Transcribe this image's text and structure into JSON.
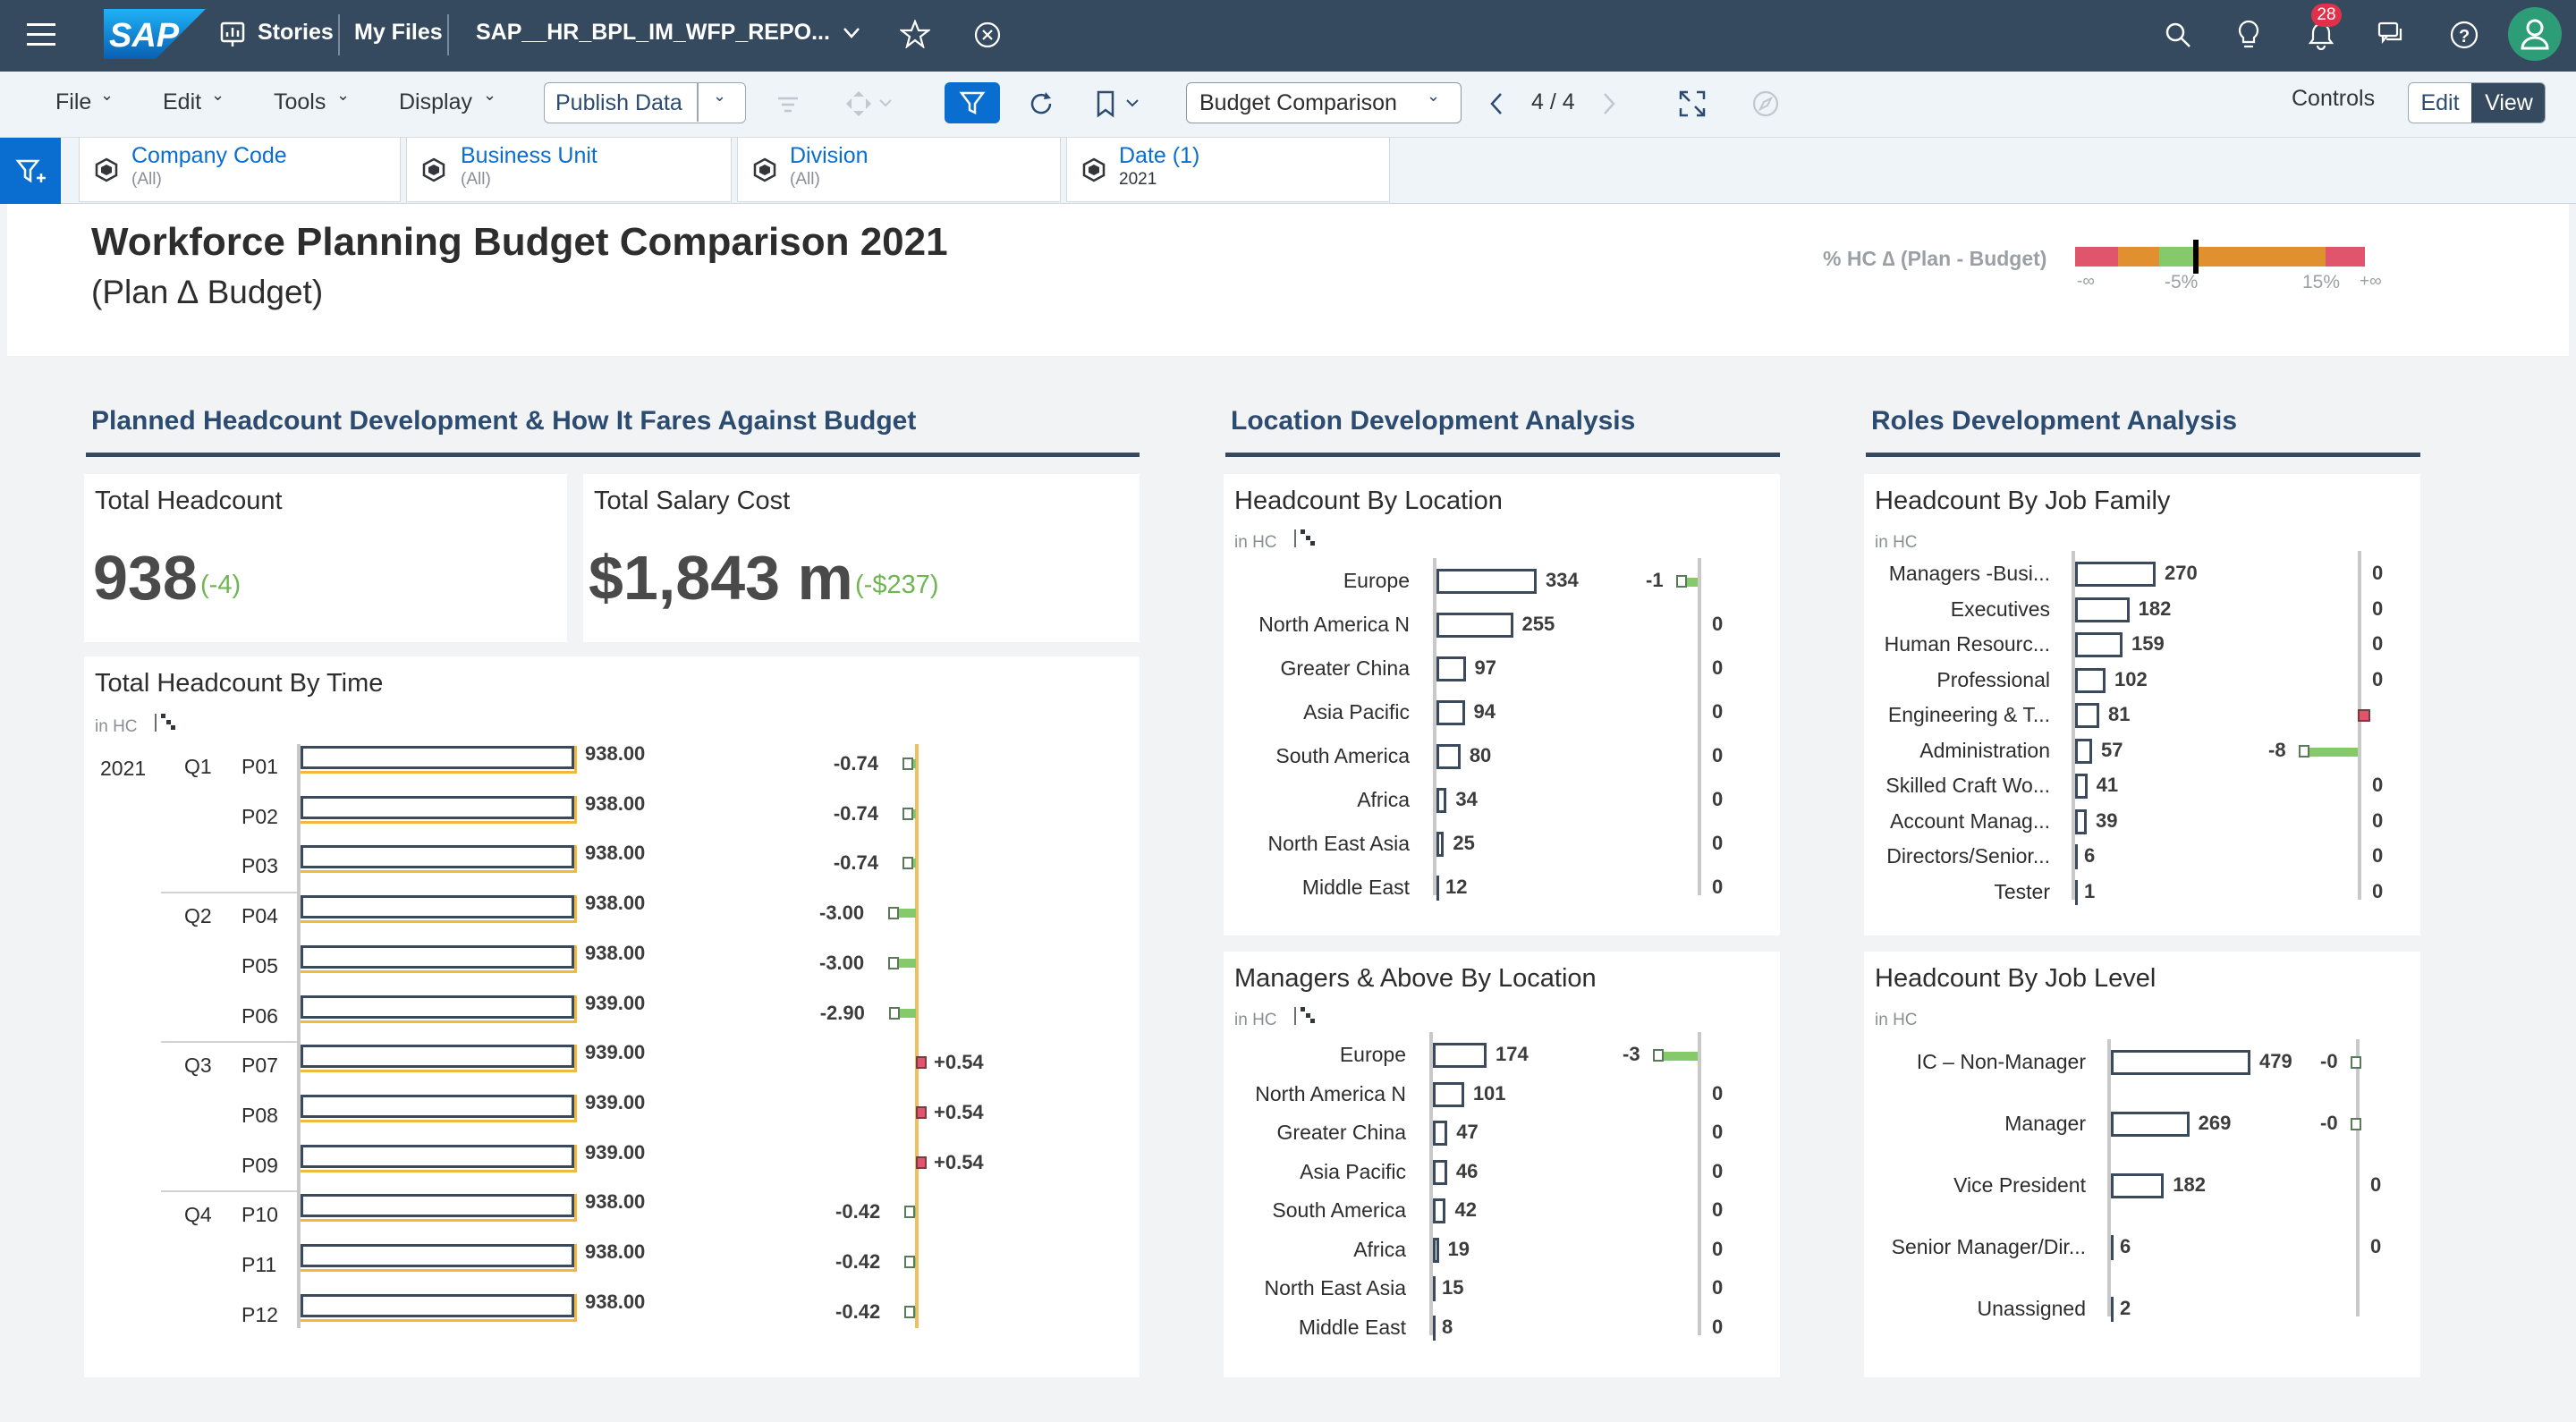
{
  "shell": {
    "nav_stories": "Stories",
    "nav_myfiles": "My Files",
    "doc_title": "SAP__HR_BPL_IM_WFP_REPO...",
    "notification_count": "28",
    "logo_text": "SAP"
  },
  "toolbar": {
    "menus": [
      "File",
      "Edit",
      "Tools",
      "Display"
    ],
    "publish_label": "Publish Data",
    "page_select": "Budget Comparison",
    "page_counter": "4 / 4",
    "controls_label": "Controls",
    "edit_label": "Edit",
    "view_label": "View"
  },
  "filters": [
    {
      "name": "Company Code",
      "value": "(All)"
    },
    {
      "name": "Business Unit",
      "value": "(All)"
    },
    {
      "name": "Division",
      "value": "(All)"
    },
    {
      "name": "Date (1)",
      "value": "2021"
    }
  ],
  "header": {
    "title": "Workforce Planning Budget Comparison 2021",
    "subtitle": "(Plan ∆ Budget)",
    "legend_label": "% HC ∆ (Plan - Budget)",
    "legend_ticks": [
      "-∞",
      "-5%",
      "15%",
      "+∞"
    ],
    "legend_colors": [
      "#e0556b",
      "#e0902f",
      "#86c96b",
      "#86c96b",
      "#e0902f",
      "#e0556b"
    ]
  },
  "sections": {
    "left": "Planned Headcount Development & How It Fares Against Budget",
    "mid": "Location Development Analysis",
    "right": "Roles Development Analysis"
  },
  "kpi": {
    "headcount_title": "Total Headcount",
    "headcount_value": "938",
    "headcount_delta": "(-4)",
    "salary_title": "Total Salary Cost",
    "salary_value": "$1,843 m",
    "salary_delta": "(-$237)"
  },
  "unit_label": "in HC",
  "chart_data": [
    {
      "type": "bar",
      "title": "Total Headcount By Time",
      "year": "2021",
      "quarters": [
        "Q1",
        "Q2",
        "Q3",
        "Q4"
      ],
      "categories": [
        "P01",
        "P02",
        "P03",
        "P04",
        "P05",
        "P06",
        "P07",
        "P08",
        "P09",
        "P10",
        "P11",
        "P12"
      ],
      "values": [
        938.0,
        938.0,
        938.0,
        938.0,
        938.0,
        939.0,
        939.0,
        939.0,
        939.0,
        938.0,
        938.0,
        938.0
      ],
      "value_labels": [
        "938.00",
        "938.00",
        "938.00",
        "938.00",
        "938.00",
        "939.00",
        "939.00",
        "939.00",
        "939.00",
        "938.00",
        "938.00",
        "938.00"
      ],
      "variance": [
        -0.74,
        -0.74,
        -0.74,
        -3.0,
        -3.0,
        -2.9,
        0.54,
        0.54,
        0.54,
        -0.42,
        -0.42,
        -0.42
      ],
      "variance_labels": [
        "-0.74",
        "-0.74",
        "-0.74",
        "-3.00",
        "-3.00",
        "-2.90",
        "+0.54",
        "+0.54",
        "+0.54",
        "-0.42",
        "-0.42",
        "-0.42"
      ]
    },
    {
      "type": "bar",
      "title": "Headcount By Location",
      "categories": [
        "Europe",
        "North America N",
        "Greater China",
        "Asia Pacific",
        "South America",
        "Africa",
        "North East Asia",
        "Middle East"
      ],
      "values": [
        334,
        255,
        97,
        94,
        80,
        34,
        25,
        12
      ],
      "variance": [
        -1,
        0,
        0,
        0,
        0,
        0,
        0,
        0
      ],
      "variance_labels": [
        "-1",
        "0",
        "0",
        "0",
        "0",
        "0",
        "0",
        "0"
      ]
    },
    {
      "type": "bar",
      "title": "Managers & Above By Location",
      "categories": [
        "Europe",
        "North America N",
        "Greater China",
        "Asia Pacific",
        "South America",
        "Africa",
        "North East Asia",
        "Middle East"
      ],
      "values": [
        174,
        101,
        47,
        46,
        42,
        19,
        15,
        8
      ],
      "variance": [
        -3,
        0,
        0,
        0,
        0,
        0,
        0,
        0
      ],
      "variance_labels": [
        "-3",
        "0",
        "0",
        "0",
        "0",
        "0",
        "0",
        "0"
      ]
    },
    {
      "type": "bar",
      "title": "Headcount By Job Family",
      "categories": [
        "Managers -Busi...",
        "Executives",
        "Human Resourc...",
        "Professional",
        "Engineering & T...",
        "Administration",
        "Skilled Craft Wo...",
        "Account Manag...",
        "Directors/Senior...",
        "Tester"
      ],
      "values": [
        270,
        182,
        159,
        102,
        81,
        57,
        41,
        39,
        6,
        1
      ],
      "variance": [
        0,
        0,
        0,
        0,
        0.3,
        -8,
        0,
        0,
        0,
        0
      ],
      "variance_labels": [
        "0",
        "0",
        "0",
        "0",
        "",
        "-8",
        "0",
        "0",
        "0",
        "0"
      ]
    },
    {
      "type": "bar",
      "title": "Headcount By Job Level",
      "categories": [
        "IC – Non-Manager",
        "Manager",
        "Vice President",
        "Senior Manager/Dir...",
        "Unassigned"
      ],
      "values": [
        479,
        269,
        182,
        6,
        2
      ],
      "variance": [
        0,
        0,
        0,
        0,
        0
      ],
      "variance_labels": [
        "-0",
        "-0",
        "0",
        "0",
        ""
      ]
    }
  ]
}
